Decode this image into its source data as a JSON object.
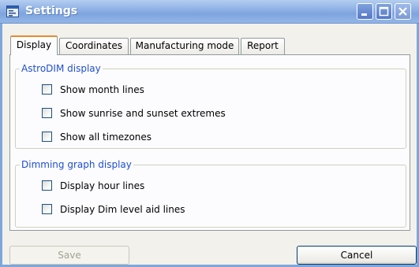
{
  "window": {
    "title": "Settings",
    "icons": {
      "app": "settings-app-icon",
      "minimize": "minimize-icon",
      "maximize": "maximize-icon",
      "close": "close-icon"
    }
  },
  "tabs": [
    {
      "label": "Display",
      "active": true
    },
    {
      "label": "Coordinates",
      "active": false
    },
    {
      "label": "Manufacturing mode",
      "active": false
    },
    {
      "label": "Report",
      "active": false
    }
  ],
  "astrodim_group": {
    "title": "AstroDIM display",
    "options": [
      {
        "label": "Show month lines",
        "checked": false
      },
      {
        "label": "Show sunrise and sunset extremes",
        "checked": false
      },
      {
        "label": "Show all timezones",
        "checked": false
      }
    ]
  },
  "dimming_group": {
    "title": "Dimming graph display",
    "options": [
      {
        "label": "Display hour lines",
        "checked": false
      },
      {
        "label": "Display Dim level aid lines",
        "checked": false
      }
    ]
  },
  "buttons": {
    "save_label": "Save",
    "save_enabled": false,
    "cancel_label": "Cancel"
  },
  "colors": {
    "group_title": "#1f4fd0",
    "active_tab_accent": "#e68b2c",
    "titlebar": "#8fb2e6"
  }
}
